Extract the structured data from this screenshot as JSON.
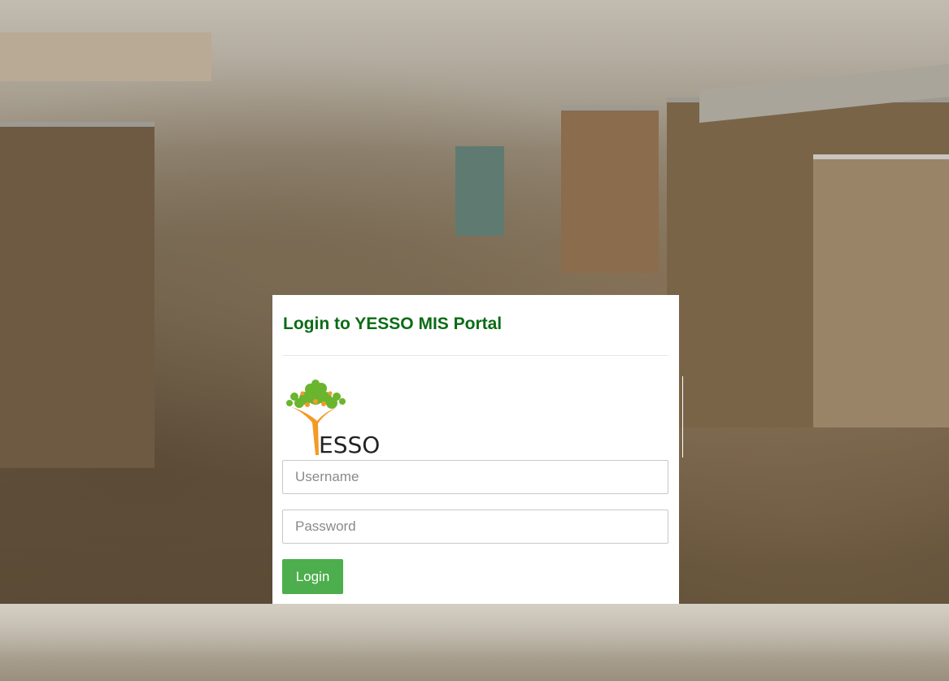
{
  "login": {
    "title": "Login to YESSO MIS Portal",
    "logo_text": "ESSO",
    "logo_initial": "Y",
    "username_placeholder": "Username",
    "password_placeholder": "Password",
    "submit_label": "Login"
  },
  "colors": {
    "title": "#0b6b16",
    "button": "#4cae4c",
    "logo_tree": "#6bb52e",
    "logo_trunk": "#f39a26"
  }
}
